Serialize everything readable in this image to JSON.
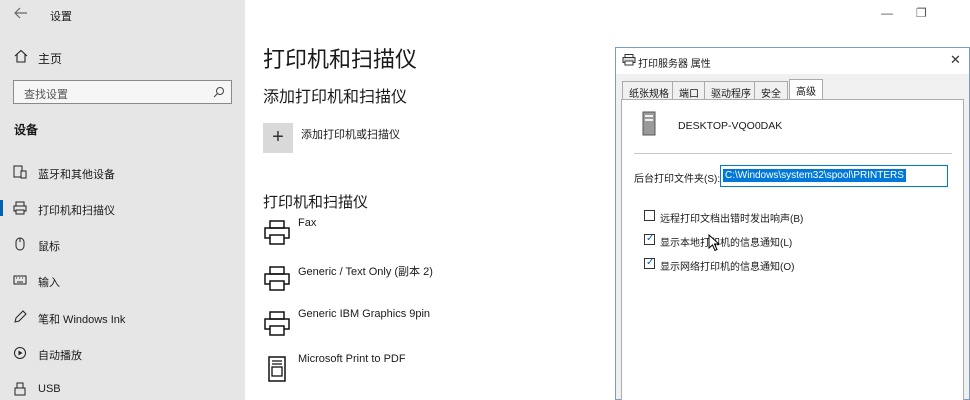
{
  "window": {
    "title": "设置",
    "minimize_glyph": "—",
    "restore_glyph": "❐"
  },
  "sidebar": {
    "home_label": "主页",
    "search_placeholder": "查找设置",
    "section_label": "设备",
    "items": [
      {
        "label": "蓝牙和其他设备",
        "icon": "devices-icon"
      },
      {
        "label": "打印机和扫描仪",
        "icon": "printer-icon",
        "active": true
      },
      {
        "label": "鼠标",
        "icon": "mouse-icon"
      },
      {
        "label": "输入",
        "icon": "keyboard-icon"
      },
      {
        "label": "笔和 Windows Ink",
        "icon": "pen-icon"
      },
      {
        "label": "自动播放",
        "icon": "autoplay-icon"
      },
      {
        "label": "USB",
        "icon": "usb-icon"
      }
    ]
  },
  "main": {
    "title": "打印机和扫描仪",
    "add_section": "添加打印机和扫描仪",
    "add_button_label": "添加打印机或扫描仪",
    "list_section": "打印机和扫描仪",
    "printers": [
      {
        "name": "Fax"
      },
      {
        "name": "Generic / Text Only (副本 2)"
      },
      {
        "name": "Generic IBM Graphics 9pin"
      },
      {
        "name": "Microsoft Print to PDF"
      }
    ]
  },
  "dialog": {
    "title": "打印服务器 属性",
    "tabs": [
      "纸张规格",
      "端口",
      "驱动程序",
      "安全",
      "高级"
    ],
    "active_tab": "高级",
    "server_name": "DESKTOP-VQO0DAK",
    "spool_label": "后台打印文件夹(S):",
    "spool_value": "C:\\Windows\\system32\\spool\\PRINTERS",
    "checkboxes": [
      {
        "label": "远程打印文档出错时发出响声(B)",
        "checked": false
      },
      {
        "label": "显示本地打印机的信息通知(L)",
        "checked": true
      },
      {
        "label": "显示网络打印机的信息通知(O)",
        "checked": true
      }
    ],
    "check_glyph": "✓"
  },
  "colors": {
    "accent": "#0063b1",
    "selection": "#0078d7",
    "sidebar_bg": "#e6e6e6"
  }
}
